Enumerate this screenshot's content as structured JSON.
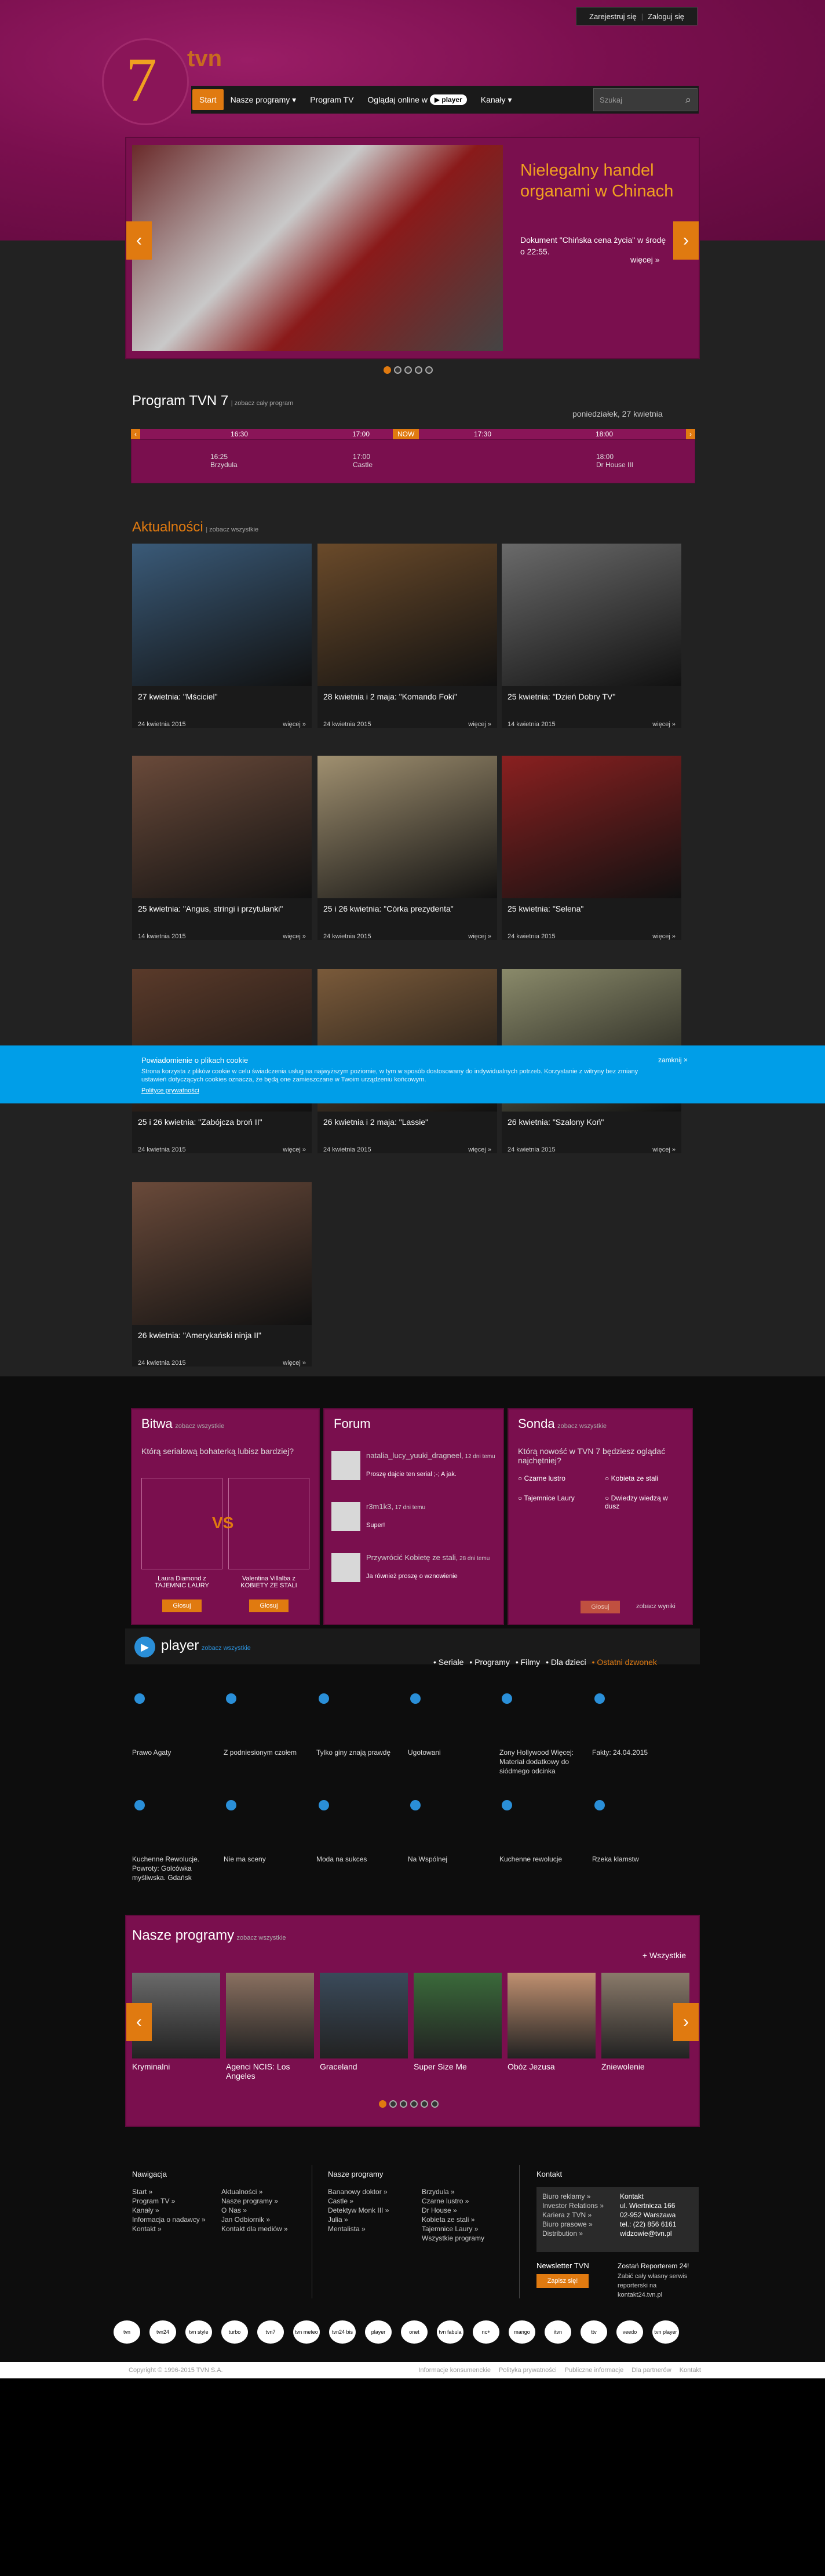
{
  "auth": {
    "register": "Zarejestruj się",
    "login": "Zaloguj się"
  },
  "logo": {
    "number": "7",
    "brand": "tvn"
  },
  "nav": {
    "start": "Start",
    "items": [
      "Nasze programy",
      "Program TV",
      "Oglądaj online w",
      "Kanały"
    ],
    "player_badge": "player",
    "search_placeholder": "Szukaj"
  },
  "hero": {
    "title": "Nielegalny handel organami w Chinach",
    "description": "Dokument \"Chińska cena życia\" w środę o 22:55.",
    "more": "więcej »"
  },
  "schedule": {
    "title": "Program TVN 7",
    "see_all": "zobacz cały program",
    "date": "poniedziałek, 27 kwietnia",
    "times": [
      "16:30",
      "17:00",
      "17:30",
      "18:00"
    ],
    "now": "NOW",
    "shows": [
      {
        "time": "16:25",
        "name": "Brzydula"
      },
      {
        "time": "17:00",
        "name": "Castle"
      },
      {
        "time": "18:00",
        "name": "Dr House III"
      }
    ]
  },
  "news": {
    "title": "Aktualności",
    "see_all": "zobacz wszystkie",
    "more": "więcej »",
    "items": [
      {
        "caption": "27 kwietnia: \"Mściciel\"",
        "date": "24 kwietnia 2015",
        "color": "#3a5a78"
      },
      {
        "caption": "28 kwietnia i 2 maja: \"Komando Foki\"",
        "date": "24 kwietnia 2015",
        "color": "#6a4a2a"
      },
      {
        "caption": "25 kwietnia: \"Dzień Dobry TV\"",
        "date": "14 kwietnia 2015",
        "color": "#6a6a6a"
      },
      {
        "caption": "25 kwietnia: \"Angus, stringi i przytulanki\"",
        "date": "14 kwietnia 2015",
        "color": "#6a4a3a"
      },
      {
        "caption": "25 i 26 kwietnia: \"Córka prezydenta\"",
        "date": "24 kwietnia 2015",
        "color": "#a09070"
      },
      {
        "caption": "25 kwietnia: \"Selena\"",
        "date": "24 kwietnia 2015",
        "color": "#8a2020"
      },
      {
        "caption": "25 i 26 kwietnia: \"Zabójcza broń II\"",
        "date": "24 kwietnia 2015",
        "color": "#5a3a2a"
      },
      {
        "caption": "26 kwietnia i 2 maja: \"Lassie\"",
        "date": "24 kwietnia 2015",
        "color": "#7a5a3a"
      },
      {
        "caption": "26 kwietnia: \"Szalony Koń\"",
        "date": "24 kwietnia 2015",
        "color": "#8a8a6a"
      },
      {
        "caption": "26 kwietnia: \"Amerykański ninja II\"",
        "date": "24 kwietnia 2015",
        "color": "#6a4a3a"
      }
    ]
  },
  "cookie": {
    "title": "Powiadomienie o plikach cookie",
    "text": "Strona korzysta z plików cookie w celu świadczenia usług na najwyższym poziomie, w tym w sposób dostosowany do indywidualnych potrzeb. Korzystanie z witryny bez zmiany ustawień dotyczących cookies oznacza, że będą one zamieszczane w Twoim urządzeniu końcowym.",
    "link": "Polityce prywatności",
    "close": "zamknij ×"
  },
  "battle": {
    "title": "Bitwa",
    "see_all": "zobacz wszystkie",
    "question": "Którą serialową bohaterką lubisz bardziej?",
    "vs": "VS",
    "left": "Laura Diamond z TAJEMNIC LAURY",
    "right": "Valentina Villalba z KOBIETY ZE STALI",
    "vote": "Głosuj"
  },
  "forum": {
    "title": "Forum",
    "posts": [
      {
        "user": "natalia_lucy_yuuki_dragneel,",
        "time": "12 dni temu",
        "text": "Proszę dajcie ten serial ;-; A jak."
      },
      {
        "user": "r3m1k3,",
        "time": "17 dni temu",
        "text": "Super!"
      },
      {
        "user": "Przywrócić Kobietę ze stali,",
        "time": "28 dni temu",
        "text": "Ja również proszę o wznowienie"
      }
    ]
  },
  "poll": {
    "title": "Sonda",
    "see_all": "zobacz wszystkie",
    "question": "Którą nowość w TVN 7 będziesz oglądać najchętniej?",
    "options": [
      "Czarne lustro",
      "Kobieta ze stali",
      "Tajemnice Laury",
      "Dwiedzy wiedzą w dusz"
    ],
    "vote": "Głosuj",
    "results": "zobacz wyniki"
  },
  "player": {
    "title": "player",
    "see_all": "zobacz wszystkie",
    "tabs": [
      "Seriale",
      "Programy",
      "Filmy",
      "Dla dzieci",
      "Ostatni dzwonek"
    ],
    "videos": [
      "Prawo Agaty",
      "Z podniesionym czołem",
      "Tylko giny znają prawdę",
      "Ugotowani",
      "Zony Hollywood Więcej: Materiał dodatkowy do siódmego odcinka",
      "Fakty: 24.04.2015",
      "Kuchenne Rewolucje. Powroty: Golcówka myśliwska. Gdańsk",
      "Nie ma sceny",
      "Moda na sukces",
      "Na Wspólnej",
      "Kuchenne rewolucje",
      "Rzeka klamstw"
    ]
  },
  "programs": {
    "title": "Nasze programy",
    "see_all": "zobacz wszystkie",
    "all": "Wszystkie",
    "items": [
      {
        "name": "Kryminalni",
        "color": "#6a6a6a"
      },
      {
        "name": "Agenci NCIS: Los Angeles",
        "color": "#8a7060"
      },
      {
        "name": "Graceland",
        "color": "#3a4a5a"
      },
      {
        "name": "Super Size Me",
        "color": "#3a6a3a"
      },
      {
        "name": "Obóz Jezusa",
        "color": "#c09070"
      },
      {
        "name": "Zniewolenie",
        "color": "#8a7a6a"
      }
    ]
  },
  "footer": {
    "nav_title": "Nawigacja",
    "nav_col1": [
      "Start »",
      "Program TV »",
      "Kanały »",
      "Informacja o nadawcy »",
      "Kontakt »"
    ],
    "nav_col2": [
      "Aktualności »",
      "Nasze programy »",
      "O Nas »",
      "Jan Odbiornik »",
      "Kontakt dla mediów »"
    ],
    "prog_title": "Nasze programy",
    "prog_col1": [
      "Bananowy doktor »",
      "Castle »",
      "Detektyw Monk III »",
      "Julia »",
      "Mentalista »"
    ],
    "prog_col2": [
      "Brzydula »",
      "Czarne lustro »",
      "Dr House »",
      "Kobieta ze stali »",
      "Tajemnice Laury »",
      "Wszystkie programy"
    ],
    "contact_title": "Kontakt",
    "contact_links": [
      "Biuro reklamy »",
      "Investor Relations »",
      "Kariera z TVN »",
      "Biuro prasowe »",
      "Distribution »"
    ],
    "contact_addr": [
      "Kontakt",
      "ul. Wiertnicza 166",
      "02-952 Warszawa",
      "tel.: (22) 856 6161",
      "widzowie@tvn.pl"
    ],
    "newsletter": "Newsletter TVN",
    "signup": "Zapisz się!",
    "reporter_title": "Zostań Reporterem 24!",
    "reporter_text": "Zabić cały własny serwis reporterski na kontakt24.tvn.pl"
  },
  "partner_logos": [
    "tvn",
    "tvn24",
    "tvn style",
    "turbo",
    "tvn7",
    "tvn meteo",
    "tvn24 bis",
    "player",
    "onet",
    "tvn fabula",
    "nc+",
    "mango",
    "itvn",
    "ttv",
    "veedo",
    "tvn player"
  ],
  "bottom": {
    "copyright": "Copyright © 1996-2015 TVN S.A.",
    "links": [
      "Informacje konsumenckie",
      "Polityka prywatności",
      "Publiczne informacje",
      "Dla partnerów",
      "Kontakt"
    ]
  }
}
